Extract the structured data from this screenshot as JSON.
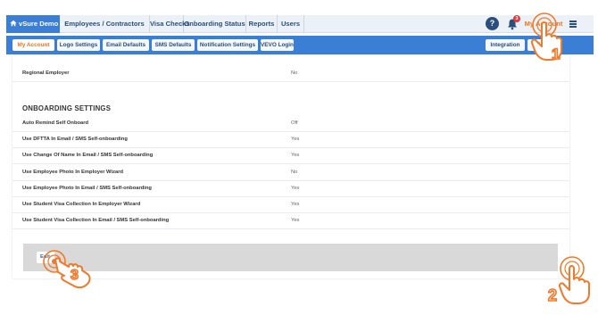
{
  "topnav": {
    "brand": "vSure Demo »",
    "items": [
      "Employees / Contractors",
      "Visa Checks",
      "Onboarding Status",
      "Reports",
      "Users"
    ],
    "notification_count": "3",
    "my_account": "My Account"
  },
  "subnav": {
    "left": [
      "My Account",
      "Logo Settings",
      "Email Defaults",
      "SMS Defaults",
      "Notification Settings",
      "VEVO Login"
    ],
    "right": [
      "Integration",
      "E"
    ]
  },
  "regional_employer": {
    "label": "Regional Employer",
    "value": "No"
  },
  "onboarding": {
    "title": "ONBOARDING SETTINGS",
    "rows": [
      {
        "label": "Auto Remind Self Onboard",
        "value": "Off"
      },
      {
        "label": "Use DFTTA In Email / SMS Self-onboarding",
        "value": "Yes"
      },
      {
        "label": "Use Change Of Name In Email / SMS Self-onboarding",
        "value": "Yes"
      },
      {
        "label": "Use Employee Photo In Employer Wizard",
        "value": "No"
      },
      {
        "label": "Use Employee Photo In Email / SMS Self-onboarding",
        "value": "Yes"
      },
      {
        "label": "Use Student Visa Collection In Employer Wizard",
        "value": "Yes"
      },
      {
        "label": "Use Student Visa Collection In Email / SMS Self-onboarding",
        "value": "Yes"
      }
    ]
  },
  "edit_button": "Edit",
  "annotations": [
    "1",
    "2",
    "3"
  ],
  "colors": {
    "nav_blue": "#3a7fd5",
    "accent_orange": "#e87722",
    "text_navy": "#2b4f7a",
    "footer_gray": "#d9d9d9"
  }
}
